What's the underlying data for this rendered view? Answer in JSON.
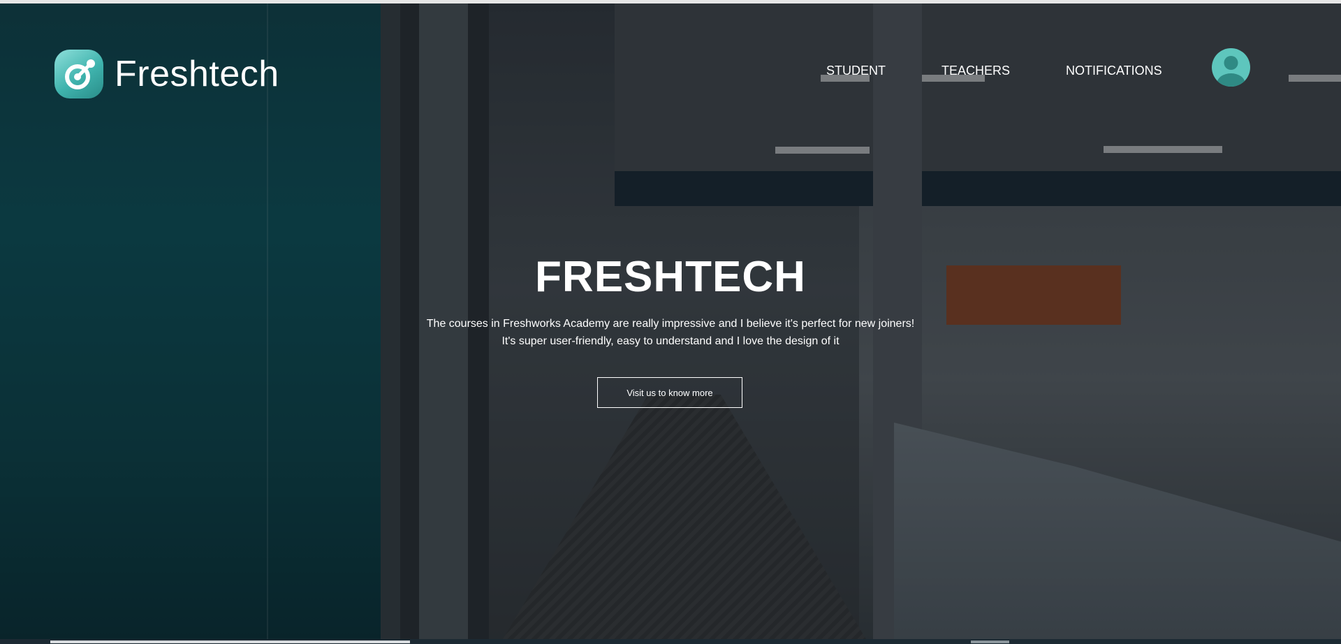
{
  "brand": {
    "name": "Freshtech",
    "logo_icon": "freshtech-logo-icon"
  },
  "nav": {
    "items": [
      {
        "label": "STUDENT"
      },
      {
        "label": "TEACHERS"
      },
      {
        "label": "NOTIFICATIONS"
      }
    ],
    "avatar_icon": "user-avatar-icon"
  },
  "hero": {
    "title": "FRESHTECH",
    "line1": "The courses in Freshworks Academy are really impressive and I believe it's perfect for new joiners!",
    "line2": "It's super user-friendly, easy to understand and I love the design of it",
    "cta_label": "Visit us to know more"
  },
  "colors": {
    "accent": "#5ec6bd",
    "text": "#ffffff",
    "overlay": "#0a1218"
  }
}
